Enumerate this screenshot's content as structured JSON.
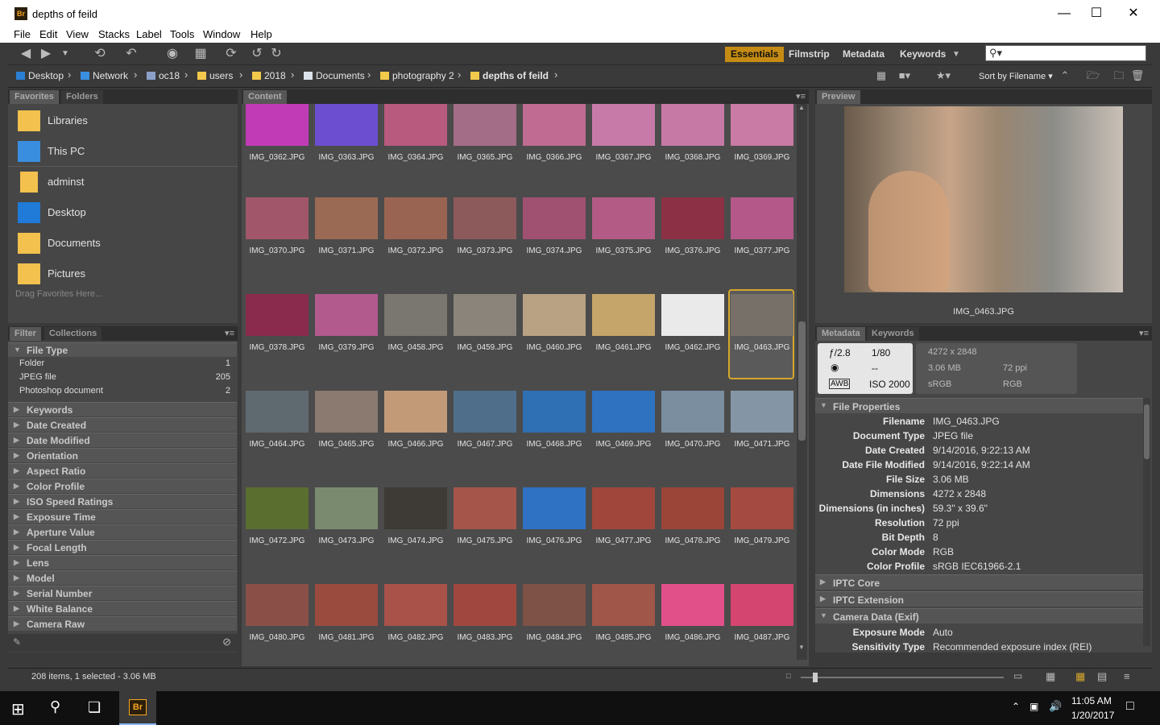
{
  "window": {
    "title": "depths of feild",
    "app_icon": "Br"
  },
  "menu": [
    "File",
    "Edit",
    "View",
    "Stacks",
    "Label",
    "Tools",
    "Window",
    "Help"
  ],
  "workspaces": [
    "Essentials",
    "Filmstrip",
    "Metadata",
    "Keywords"
  ],
  "breadcrumbs": [
    "Desktop",
    "Network",
    "oc18",
    "users",
    "2018",
    "Documents",
    "photography 2",
    "depths of feild"
  ],
  "sort_label": "Sort by Filename",
  "favorites_tabs": [
    "Favorites",
    "Folders"
  ],
  "favorites": [
    "Libraries",
    "This PC",
    "adminst",
    "Desktop",
    "Documents",
    "Pictures"
  ],
  "favorites_hint": "Drag Favorites Here...",
  "filter_tabs": [
    "Filter",
    "Collections"
  ],
  "filter": {
    "file_type_label": "File Type",
    "file_types": [
      {
        "name": "Folder",
        "count": "1"
      },
      {
        "name": "JPEG file",
        "count": "205"
      },
      {
        "name": "Photoshop document",
        "count": "2"
      }
    ],
    "categories": [
      "Keywords",
      "Date Created",
      "Date Modified",
      "Orientation",
      "Aspect Ratio",
      "Color Profile",
      "ISO Speed Ratings",
      "Exposure Time",
      "Aperture Value",
      "Focal Length",
      "Lens",
      "Model",
      "Serial Number",
      "White Balance",
      "Camera Raw"
    ]
  },
  "content_tab": "Content",
  "thumbnails": [
    [
      "IMG_0362.JPG",
      "IMG_0363.JPG",
      "IMG_0364.JPG",
      "IMG_0365.JPG",
      "IMG_0366.JPG",
      "IMG_0367.JPG",
      "IMG_0368.JPG",
      "IMG_0369.JPG"
    ],
    [
      "IMG_0370.JPG",
      "IMG_0371.JPG",
      "IMG_0372.JPG",
      "IMG_0373.JPG",
      "IMG_0374.JPG",
      "IMG_0375.JPG",
      "IMG_0376.JPG",
      "IMG_0377.JPG"
    ],
    [
      "IMG_0378.JPG",
      "IMG_0379.JPG",
      "IMG_0458.JPG",
      "IMG_0459.JPG",
      "IMG_0460.JPG",
      "IMG_0461.JPG",
      "IMG_0462.JPG",
      "IMG_0463.JPG"
    ],
    [
      "IMG_0464.JPG",
      "IMG_0465.JPG",
      "IMG_0466.JPG",
      "IMG_0467.JPG",
      "IMG_0468.JPG",
      "IMG_0469.JPG",
      "IMG_0470.JPG",
      "IMG_0471.JPG"
    ],
    [
      "IMG_0472.JPG",
      "IMG_0473.JPG",
      "IMG_0474.JPG",
      "IMG_0475.JPG",
      "IMG_0476.JPG",
      "IMG_0477.JPG",
      "IMG_0478.JPG",
      "IMG_0479.JPG"
    ],
    [
      "IMG_0480.JPG",
      "IMG_0481.JPG",
      "IMG_0482.JPG",
      "IMG_0483.JPG",
      "IMG_0484.JPG",
      "IMG_0485.JPG",
      "IMG_0486.JPG",
      "IMG_0487.JPG"
    ]
  ],
  "thumb_colors": [
    [
      "#c13bb7",
      "#6b4fd0",
      "#b85a7e",
      "#a46d87",
      "#bf6b92",
      "#c77aa7",
      "#c779a6",
      "#c97aa5"
    ],
    [
      "#a1566a",
      "#9a6a55",
      "#9a6452",
      "#8d5a5c",
      "#a05070",
      "#b35a85",
      "#8c3045",
      "#b4588a"
    ],
    [
      "#8a2b4e",
      "#b25a8e",
      "#7a7670",
      "#8a847a",
      "#b8a283",
      "#c6a56a",
      "#eaeaea",
      "#777068"
    ],
    [
      "#5f6a70",
      "#8a7a70",
      "#c29a78",
      "#4f6e8a",
      "#2f6fb4",
      "#2f72c0",
      "#7a8ea0",
      "#8496a6"
    ],
    [
      "#5a6e2f",
      "#7a8a6f",
      "#3e3a35",
      "#a5554a",
      "#2f72c4",
      "#a0463a",
      "#9a4538",
      "#a54a40"
    ],
    [
      "#8a5048",
      "#9b4a3e",
      "#a8524a",
      "#a0483f",
      "#7e5246",
      "#a05648",
      "#e2508a",
      "#d4456f"
    ]
  ],
  "preview_tab": "Preview",
  "preview_filename": "IMG_0463.JPG",
  "metadata_tabs": [
    "Metadata",
    "Keywords"
  ],
  "metadata_summary": {
    "aperture": "ƒ/2.8",
    "shutter": "1/80",
    "metering": "--",
    "iso": "ISO 2000",
    "wb": "AWB",
    "dimensions": "4272 x 2848",
    "size": "3.06 MB",
    "ppi": "72 ppi",
    "colorspace": "sRGB",
    "mode": "RGB"
  },
  "file_properties_label": "File Properties",
  "file_properties": [
    {
      "k": "Filename",
      "v": "IMG_0463.JPG"
    },
    {
      "k": "Document Type",
      "v": "JPEG file"
    },
    {
      "k": "Date Created",
      "v": "9/14/2016, 9:22:13 AM"
    },
    {
      "k": "Date File Modified",
      "v": "9/14/2016, 9:22:14 AM"
    },
    {
      "k": "File Size",
      "v": "3.06 MB"
    },
    {
      "k": "Dimensions",
      "v": "4272 x 2848"
    },
    {
      "k": "Dimensions (in inches)",
      "v": "59.3\" x 39.6\""
    },
    {
      "k": "Resolution",
      "v": "72 ppi"
    },
    {
      "k": "Bit Depth",
      "v": "8"
    },
    {
      "k": "Color Mode",
      "v": "RGB"
    },
    {
      "k": "Color Profile",
      "v": "sRGB IEC61966-2.1"
    }
  ],
  "metadata_sections": [
    "IPTC Core",
    "IPTC Extension",
    "Camera Data (Exif)"
  ],
  "exif": [
    {
      "k": "Exposure Mode",
      "v": "Auto"
    },
    {
      "k": "Sensitivity Type",
      "v": "Recommended exposure index (REI)"
    }
  ],
  "status": "208 items, 1 selected - 3.06 MB",
  "taskbar": {
    "time": "11:05 AM",
    "date": "1/20/2017",
    "app": "Br"
  }
}
